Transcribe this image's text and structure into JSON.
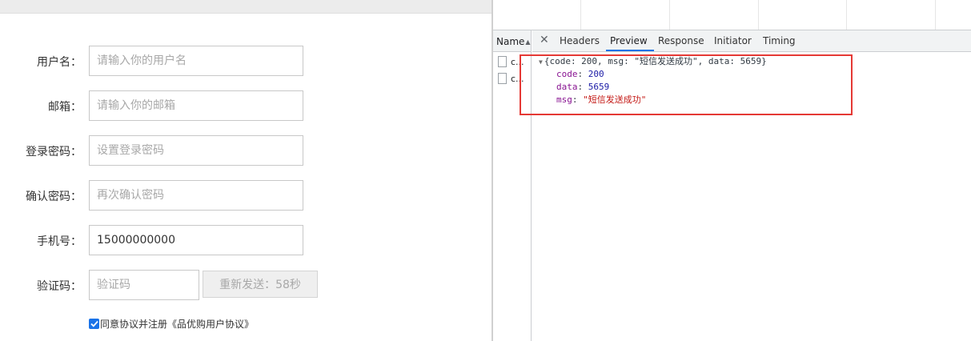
{
  "form": {
    "fields": [
      {
        "label": "用户名：",
        "value": "",
        "placeholder": "请输入你的用户名"
      },
      {
        "label": "邮箱：",
        "value": "",
        "placeholder": "请输入你的邮箱"
      },
      {
        "label": "登录密码：",
        "value": "",
        "placeholder": "设置登录密码"
      },
      {
        "label": "确认密码：",
        "value": "",
        "placeholder": "再次确认密码"
      },
      {
        "label": "手机号：",
        "value": "15000000000",
        "placeholder": ""
      },
      {
        "label": "验证码：",
        "value": "",
        "placeholder": "验证码"
      }
    ],
    "sms_button_label": "重新发送：58秒",
    "agree_text": "同意协议并注册《品优购用户协议》",
    "agree_checked": true
  },
  "devtools": {
    "name_header": "Name",
    "requests": [
      {
        "name": "c..."
      },
      {
        "name": "c..."
      }
    ],
    "tabs": [
      "Headers",
      "Preview",
      "Response",
      "Initiator",
      "Timing"
    ],
    "active_tab": "Preview",
    "preview": {
      "summary": "{code: 200, msg: \"短信发送成功\", data: 5659}",
      "props": [
        {
          "key": "code",
          "value": "200",
          "type": "number"
        },
        {
          "key": "data",
          "value": "5659",
          "type": "number"
        },
        {
          "key": "msg",
          "value": "\"短信发送成功\"",
          "type": "string"
        }
      ]
    },
    "highlight_color": "#e53935",
    "accent_color": "#1a73e8"
  }
}
